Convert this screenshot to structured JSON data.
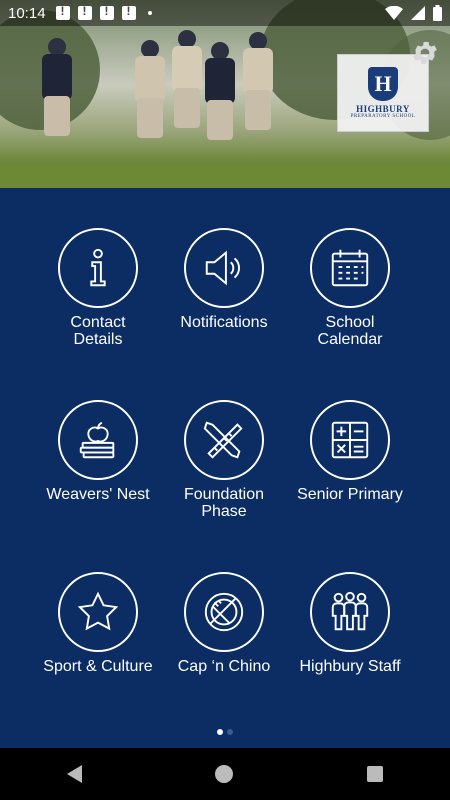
{
  "status_bar": {
    "time": "10:14",
    "notification_icons": [
      "alert-icon",
      "alert-icon",
      "alert-icon",
      "alert-icon"
    ]
  },
  "header": {
    "logo_letter": "H",
    "logo_name": "HIGHBURY",
    "logo_subtitle": "PREPARATORY SCHOOL"
  },
  "tiles": [
    {
      "label": "Contact\nDetails",
      "icon": "info-icon"
    },
    {
      "label": "Notifications",
      "icon": "speaker-icon"
    },
    {
      "label": "School\nCalendar",
      "icon": "calendar-icon"
    },
    {
      "label": "Weavers' Nest",
      "icon": "apple-books-icon"
    },
    {
      "label": "Foundation\nPhase",
      "icon": "pencil-ruler-icon"
    },
    {
      "label": "Senior Primary",
      "icon": "calculator-icon"
    },
    {
      "label": "Sport & Culture",
      "icon": "star-icon"
    },
    {
      "label": "Cap ‘n Chino",
      "icon": "plate-cutlery-icon"
    },
    {
      "label": "Highbury Staff",
      "icon": "people-icon"
    }
  ],
  "pager": {
    "page_count": 2,
    "active_page": 1
  },
  "colors": {
    "background": "#0b2d63",
    "icon_stroke": "#ffffff"
  }
}
